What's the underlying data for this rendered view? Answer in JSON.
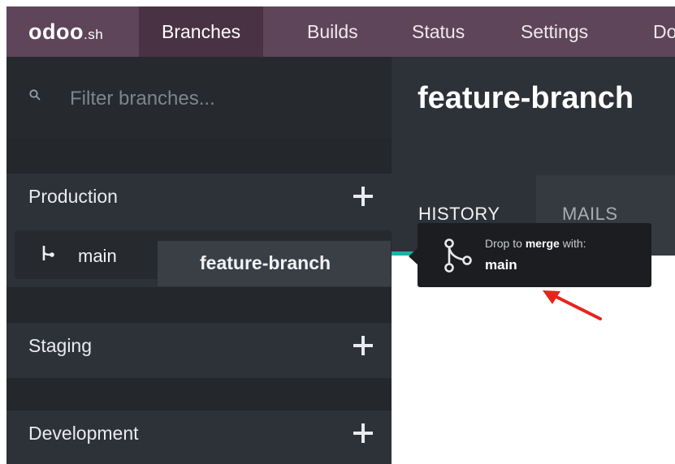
{
  "topnav": {
    "logo_main": "odoo",
    "logo_suffix": ".sh",
    "items": [
      {
        "label": "Branches",
        "active": true
      },
      {
        "label": "Builds"
      },
      {
        "label": "Status"
      },
      {
        "label": "Settings"
      },
      {
        "label": "Do"
      }
    ]
  },
  "sidebar": {
    "search": {
      "placeholder": "Filter branches...",
      "icon": "search-icon"
    },
    "sections": [
      {
        "title": "Production",
        "branches": [
          {
            "name": "main",
            "icon": "branch-icon"
          }
        ]
      },
      {
        "title": "Staging"
      },
      {
        "title": "Development"
      }
    ],
    "dragged_branch": "feature-branch"
  },
  "main": {
    "branch_title": "feature-branch",
    "tabs": [
      {
        "label": "HISTORY",
        "active": true
      },
      {
        "label": "MAILS"
      }
    ]
  },
  "tooltip": {
    "prefix": "Drop to ",
    "action": "merge",
    "suffix": " with:",
    "target": "main",
    "icon": "merge-icon"
  },
  "colors": {
    "nav_bg": "#5f4559",
    "sidebar_bg": "#2d3138",
    "accent_teal": "#1ab2a8",
    "annotation_red": "#e8231c"
  }
}
